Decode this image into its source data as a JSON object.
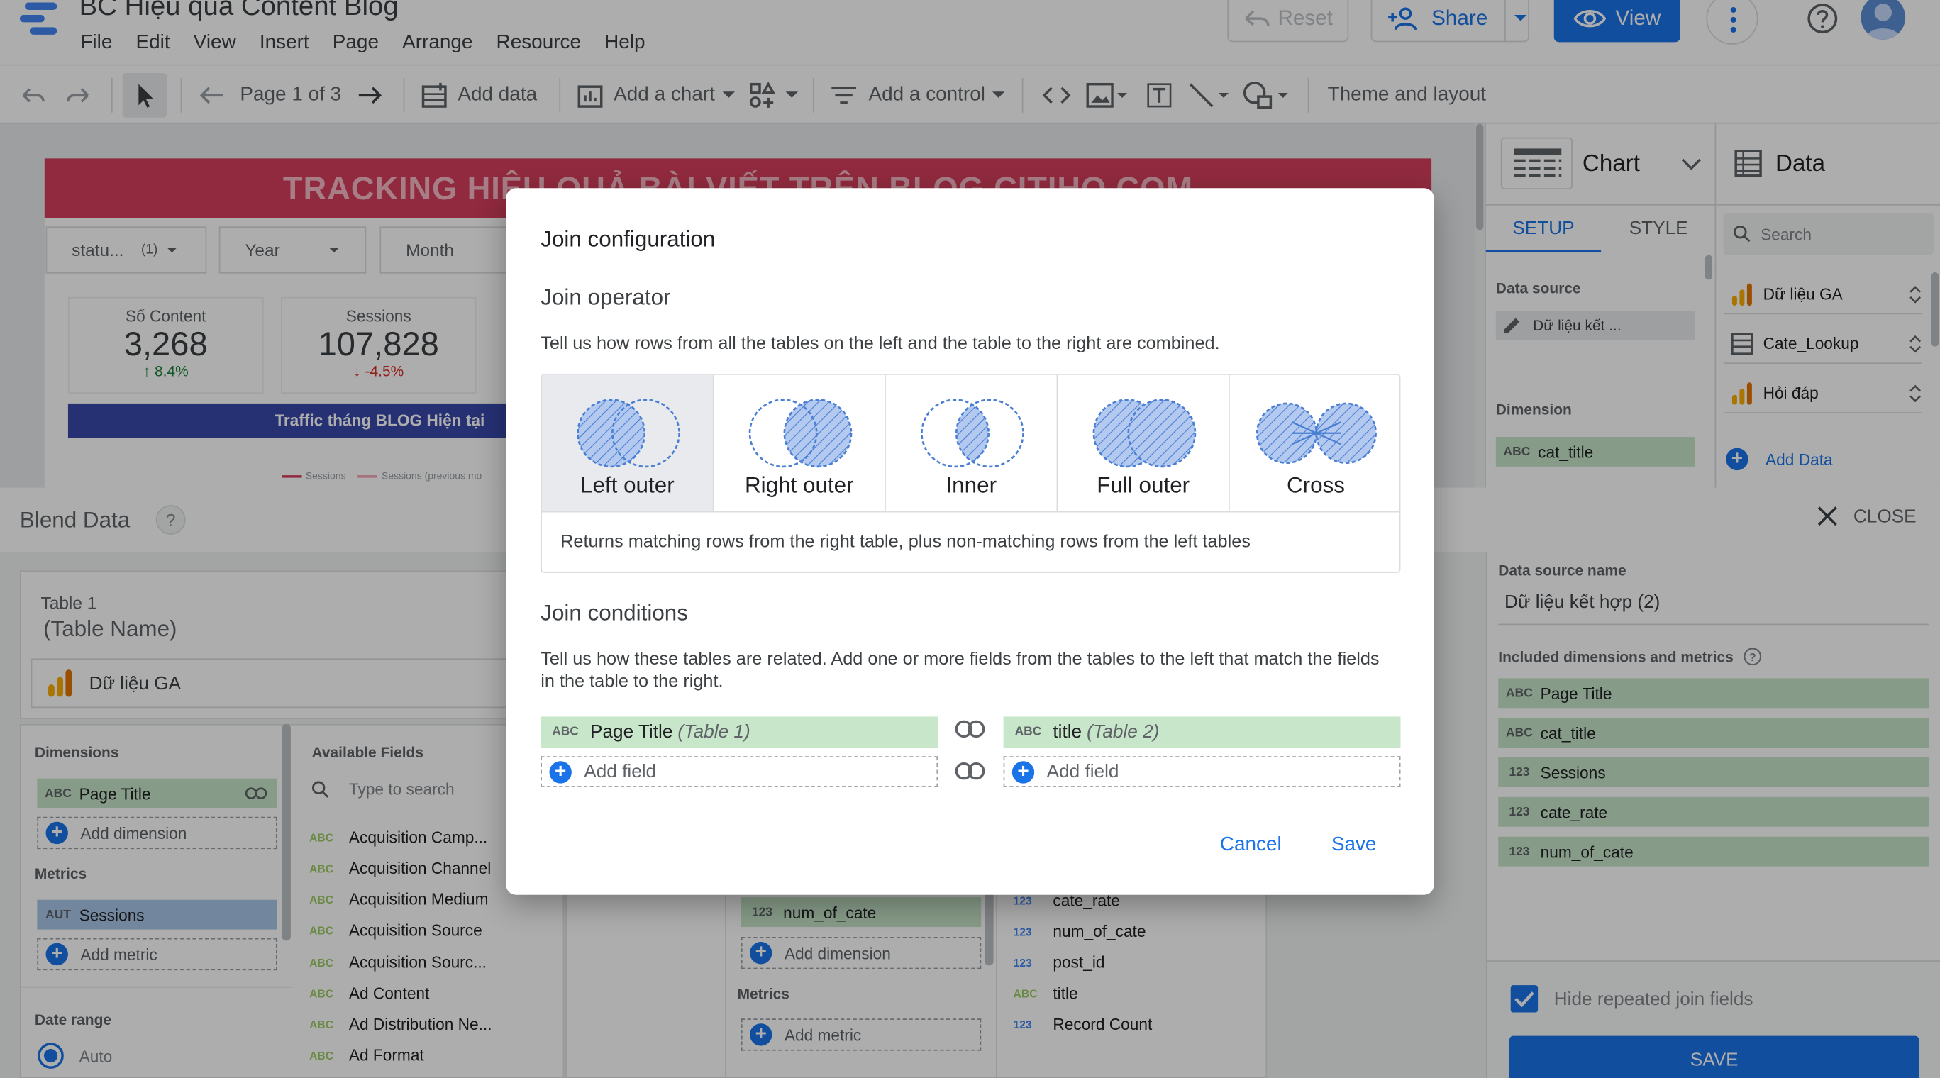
{
  "app": {
    "title": "BC Hiệu quả Content Blog",
    "menu": [
      "File",
      "Edit",
      "View",
      "Insert",
      "Page",
      "Arrange",
      "Resource",
      "Help"
    ],
    "reset_label": "Reset",
    "share_label": "Share",
    "view_label": "View"
  },
  "toolbar": {
    "page_label": "Page 1 of 3",
    "add_data": "Add data",
    "add_chart": "Add a chart",
    "add_control": "Add a control",
    "theme_layout": "Theme and layout"
  },
  "report": {
    "banner": "TRACKING HIỆU QUẢ BÀI VIẾT TRÊN BLOG CITIHO.COM",
    "filters": [
      {
        "label": "statu...",
        "count": "(1)"
      },
      {
        "label": "Year"
      },
      {
        "label": "Month"
      }
    ],
    "kpis": [
      {
        "label": "Số Content",
        "value": "3,268",
        "delta": "↑ 8.4%"
      },
      {
        "label": "Sessions",
        "value": "107,828",
        "delta": "↓ -4.5%"
      }
    ],
    "traffic_title": "Traffic tháng BLOG Hiện tại",
    "legend": [
      "Sessions",
      "Sessions (previous mo"
    ]
  },
  "chart_panel": {
    "title": "Chart",
    "tabs": [
      "SETUP",
      "STYLE"
    ],
    "data_source_label": "Data source",
    "data_source_value": "Dữ liệu kết ...",
    "dimension_label": "Dimension",
    "dimension_chip": {
      "type": "ABC",
      "name": "cat_title"
    }
  },
  "data_panel": {
    "title": "Data",
    "search_placeholder": "Search",
    "sources": [
      "Dữ liệu GA",
      "Cate_Lookup",
      "Hỏi đáp"
    ],
    "add_data": "Add Data"
  },
  "blend": {
    "title": "Blend Data",
    "help": "?",
    "close": "CLOSE",
    "table1_label": "Table 1",
    "table1_name": "(Table Name)",
    "table1_source": "Dữ liệu GA",
    "dimensions_label": "Dimensions",
    "dimension_chip": {
      "type": "ABC",
      "name": "Page Title"
    },
    "add_dimension": "Add dimension",
    "metrics_label": "Metrics",
    "metric_chip": {
      "type": "AUT",
      "name": "Sessions"
    },
    "add_metric": "Add metric",
    "date_range_label": "Date range",
    "date_range_auto": "Auto",
    "available_fields_label": "Available Fields",
    "search_placeholder": "Type to search",
    "available_fields": [
      {
        "type": "ABC",
        "name": "Acquisition Camp..."
      },
      {
        "type": "ABC",
        "name": "Acquisition Channel"
      },
      {
        "type": "ABC",
        "name": "Acquisition Medium"
      },
      {
        "type": "ABC",
        "name": "Acquisition Source"
      },
      {
        "type": "ABC",
        "name": "Acquisition Sourc..."
      },
      {
        "type": "ABC",
        "name": "Ad Content"
      },
      {
        "type": "ABC",
        "name": "Ad Distribution Ne..."
      },
      {
        "type": "ABC",
        "name": "Ad Format"
      }
    ],
    "table2_chip": {
      "type": "123",
      "name": "num_of_cate"
    },
    "table2_add_dimension": "Add dimension",
    "table2_metrics_label": "Metrics",
    "table2_add_metric": "Add metric",
    "table2_fields": [
      {
        "type": "123",
        "name": "cate_rate"
      },
      {
        "type": "123",
        "name": "num_of_cate"
      },
      {
        "type": "123",
        "name": "post_id"
      },
      {
        "type": "ABC",
        "name": "title"
      },
      {
        "type": "123",
        "name": "Record Count"
      }
    ],
    "ds_name_label": "Data source name",
    "ds_name_value": "Dữ liệu kết hợp (2)",
    "included_label": "Included dimensions and metrics",
    "included": [
      {
        "type": "ABC",
        "name": "Page Title"
      },
      {
        "type": "ABC",
        "name": "cat_title"
      },
      {
        "type": "123",
        "name": "Sessions"
      },
      {
        "type": "123",
        "name": "cate_rate"
      },
      {
        "type": "123",
        "name": "num_of_cate"
      }
    ],
    "hide_repeated": "Hide repeated join fields",
    "save": "SAVE"
  },
  "modal": {
    "title": "Join configuration",
    "operator_heading": "Join operator",
    "operator_desc": "Tell us how rows from all the tables on the left and the table to the right are combined.",
    "operators": [
      "Left outer",
      "Right outer",
      "Inner",
      "Full outer",
      "Cross"
    ],
    "selected_operator": "Left outer",
    "operator_help": "Returns matching rows from the right table, plus non-matching rows from the left tables",
    "conditions_heading": "Join conditions",
    "conditions_desc": "Tell us how these tables are related. Add one or more fields from the tables to the left that match the fields in the table to the right.",
    "left_field": {
      "type": "ABC",
      "name": "Page Title",
      "table": "(Table 1)"
    },
    "right_field": {
      "type": "ABC",
      "name": "title",
      "table": "(Table 2)"
    },
    "add_field": "Add field",
    "cancel": "Cancel",
    "save": "Save"
  },
  "colors": {
    "accent": "#1a73e8",
    "banner": "#d63f5c",
    "chip_green": "#c8e6c9",
    "chip_blue": "#a8c7e8",
    "venn_fill": "#b3c9ef",
    "venn_stroke": "#4a7fd4"
  }
}
